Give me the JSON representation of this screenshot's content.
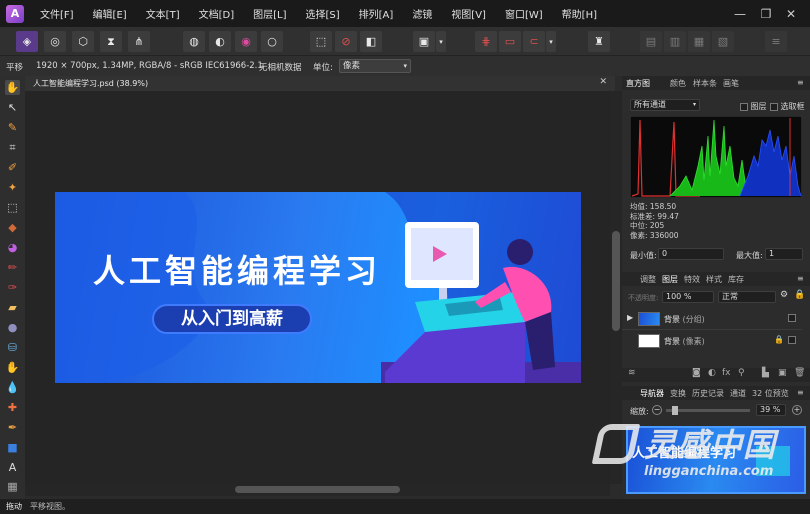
{
  "app": {
    "logo_letter": "A"
  },
  "menu": [
    "文件[F]",
    "编辑[E]",
    "文本[T]",
    "文档[D]",
    "图层[L]",
    "选择[S]",
    "排列[A]",
    "滤镜",
    "视图[V]",
    "窗口[W]",
    "帮助[H]"
  ],
  "window_controls": {
    "minimize": "—",
    "restore": "❐",
    "close": "✕"
  },
  "context_bar": {
    "tool_name": "平移",
    "doc_info": "1920 × 700px, 1.34MP, RGBA/8 - sRGB IEC61966-2.1",
    "camera_data": "无相机数据",
    "units_label": "单位:",
    "units_value": "像素"
  },
  "document": {
    "tab_title": "人工智能编程学习.psd (38.9%)",
    "close": "✕"
  },
  "artboard": {
    "title": "人工智能编程学习",
    "subtitle": "从入门到高薪"
  },
  "histogram": {
    "tabs": [
      "直方图",
      "颜色",
      "样本条",
      "画笔"
    ],
    "channel": "所有通道",
    "layer_label": "图层",
    "selection_label": "选取框",
    "stats": {
      "mean": "均值: 158.50",
      "std": "标准差: 99.47",
      "median": "中位: 205",
      "pixels": "像素: 336000"
    },
    "min_label": "最小值:",
    "min_value": "0",
    "max_label": "最大值:",
    "max_value": "1"
  },
  "layers": {
    "tabs": [
      "调整",
      "图层",
      "特效",
      "样式",
      "库存"
    ],
    "opacity_label": "不透明度:",
    "opacity": "100 %",
    "blend_mode": "正常",
    "items": [
      {
        "name": "背景",
        "type": "(分组)"
      },
      {
        "name": "背景",
        "type": "(像素)"
      }
    ]
  },
  "navigator": {
    "tabs": [
      "导航器",
      "变换",
      "历史记录",
      "通道",
      "32 位预览"
    ],
    "zoom_label": "缩放:",
    "zoom_value": "39 %"
  },
  "watermark": {
    "main": "灵感中国",
    "url": "lingganchina.com"
  },
  "status": {
    "tool": "拖动",
    "hint": "平移视图。"
  },
  "colors": {
    "accent": "#2f80ff",
    "menubar": "#1a1a1a",
    "panel": "#2c2c2c"
  }
}
